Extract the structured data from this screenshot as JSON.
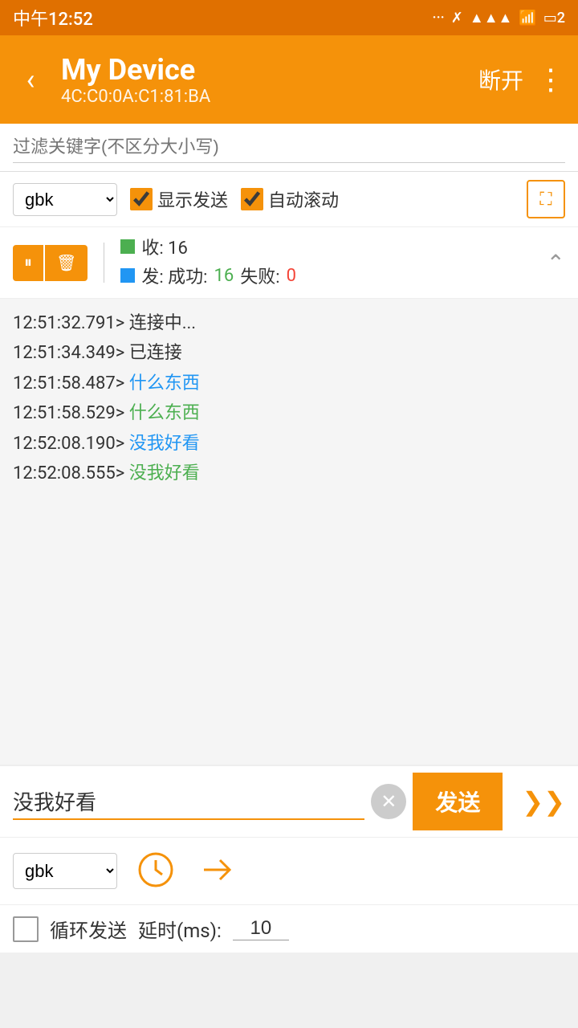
{
  "statusBar": {
    "time": "中午12:52",
    "battery": "2"
  },
  "appBar": {
    "title": "My Device",
    "subtitle": "4C:C0:0A:C1:81:BA",
    "disconnectLabel": "断开",
    "moreIcon": "⋮"
  },
  "filter": {
    "placeholder": "过滤关键字(不区分大小写)"
  },
  "controls": {
    "encoding": "gbk",
    "showSendLabel": "显示发送",
    "autoScrollLabel": "自动滚动"
  },
  "stats": {
    "recvLabel": "收: 16",
    "sendLabel": "发: 成功: 16 失败: 0",
    "sendSuccess": "16",
    "sendFail": "0"
  },
  "log": {
    "lines": [
      {
        "time": "12:51:32.791>",
        "text": " 连接中...",
        "class": "connecting"
      },
      {
        "time": "12:51:34.349>",
        "text": " 已连接",
        "class": "connected"
      },
      {
        "time": "12:51:58.487>",
        "text": " 什么东西",
        "class": "sent-blue"
      },
      {
        "time": "12:51:58.529>",
        "text": " 什么东西",
        "class": "sent-green"
      },
      {
        "time": "12:52:08.190>",
        "text": " 没我好看",
        "class": "sent-blue"
      },
      {
        "time": "12:52:08.555>",
        "text": " 没我好看",
        "class": "sent-green"
      }
    ]
  },
  "sendInput": {
    "value": "没我好看",
    "sendLabel": "发送"
  },
  "bottomControls": {
    "encoding": "gbk"
  },
  "loopRow": {
    "loopLabel": "循环发送",
    "delayLabel": "延时(ms):",
    "delayValue": "10"
  }
}
